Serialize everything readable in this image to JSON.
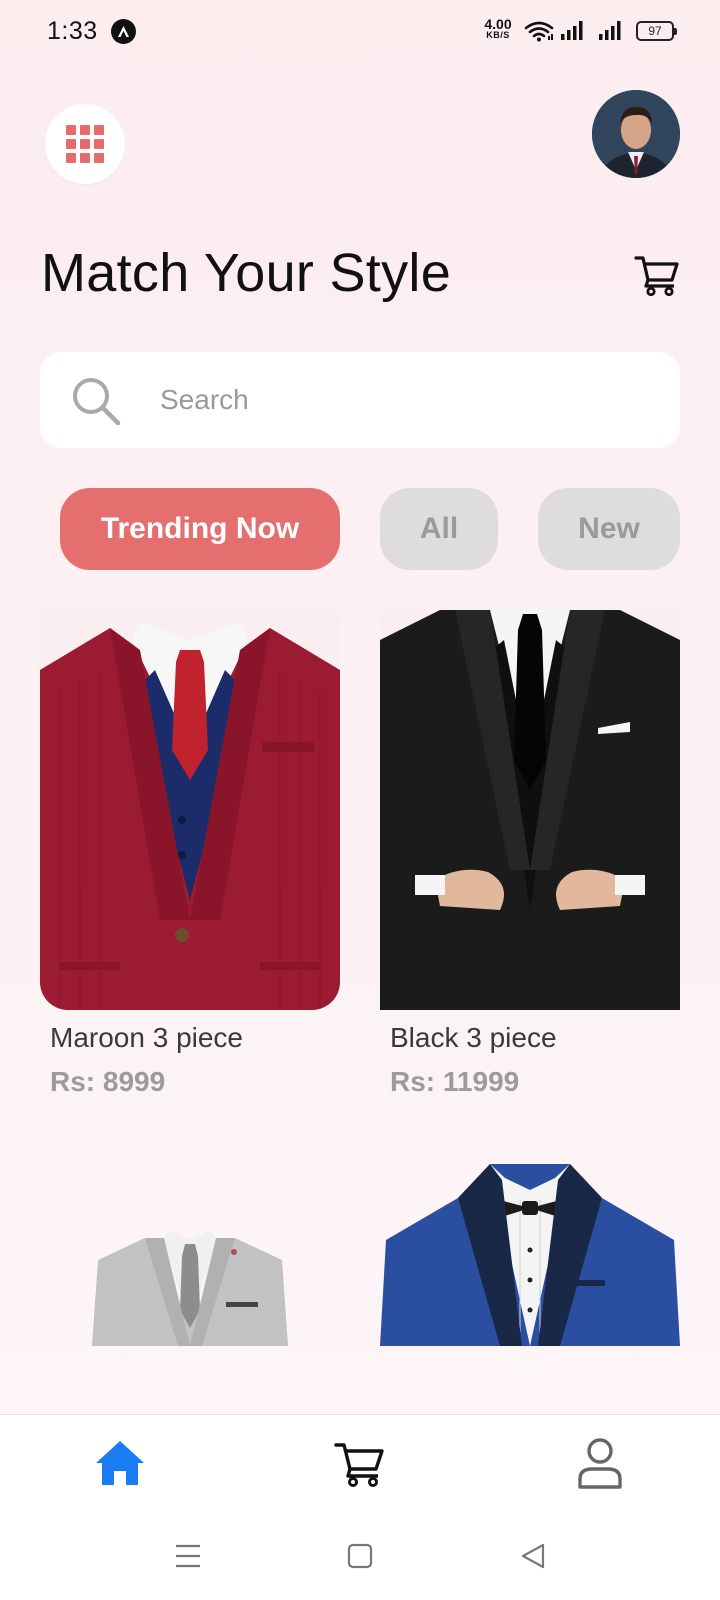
{
  "status_bar": {
    "time": "1:33",
    "net_speed_value": "4.00",
    "net_speed_unit": "KB/S",
    "battery": "97"
  },
  "header": {
    "menu_icon": "grid-menu-icon",
    "avatar_icon": "user-avatar",
    "title": "Match Your Style",
    "cart_icon": "cart-icon"
  },
  "search": {
    "placeholder": "Search",
    "value": ""
  },
  "filters": [
    {
      "label": "Trending Now",
      "active": true
    },
    {
      "label": "All",
      "active": false
    },
    {
      "label": "New",
      "active": false
    }
  ],
  "products": [
    {
      "name": "Maroon 3 piece",
      "price": "Rs: 8999"
    },
    {
      "name": "Black 3 piece",
      "price": "Rs: 11999"
    },
    {
      "name": "",
      "price": ""
    },
    {
      "name": "",
      "price": ""
    }
  ],
  "bottom_nav": [
    {
      "icon": "home-icon",
      "active": true
    },
    {
      "icon": "cart-icon",
      "active": false
    },
    {
      "icon": "profile-icon",
      "active": false
    }
  ],
  "colors": {
    "accent": "#e56e6e",
    "nav_active": "#1a7cf2",
    "chip_inactive": "#dedcdc",
    "background": "#fcedef"
  }
}
